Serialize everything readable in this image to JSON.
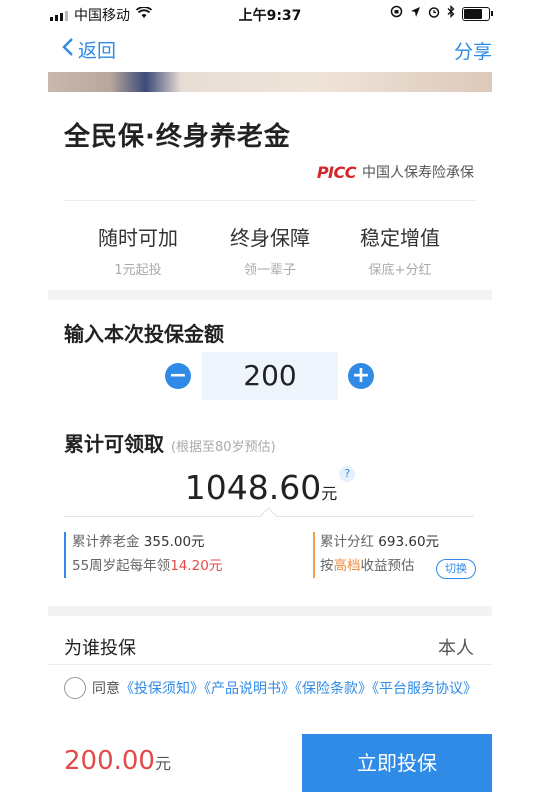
{
  "status": {
    "carrier": "中国移动",
    "time": "上午9:37"
  },
  "nav": {
    "back": "返回",
    "share": "分享"
  },
  "product": {
    "title": "全民保·终身养老金",
    "insurer_logo": "PICC",
    "insurer": "中国人保寿险承保"
  },
  "features": [
    {
      "title": "随时可加",
      "sub": "1元起投"
    },
    {
      "title": "终身保障",
      "sub": "领一辈子"
    },
    {
      "title": "稳定增值",
      "sub": "保底+分红"
    }
  ],
  "input": {
    "label": "输入本次投保金额",
    "amount": "200",
    "minus": "−",
    "plus": "+"
  },
  "total": {
    "label": "累计可领取",
    "hint": "(根据至80岁预估)",
    "value": "1048.60",
    "unit": "元",
    "help": "?"
  },
  "breakdown": {
    "pension_label": "累计养老金",
    "pension_value": "355.00元",
    "annual_prefix": "55周岁起每年领",
    "annual_value": "14.20元",
    "dividend_label": "累计分红",
    "dividend_value": "693.60元",
    "tier_prefix": "按",
    "tier_value": "高档",
    "tier_suffix": "收益预估",
    "switch": "切换"
  },
  "insured": {
    "label": "为谁投保",
    "value": "本人"
  },
  "agreement": {
    "prefix": "同意",
    "docs": [
      "《投保须知》",
      "《产品说明书》",
      "《保险条款》",
      "《平台服务协议》"
    ]
  },
  "footer": {
    "price": "200.00",
    "unit": "元",
    "buy": "立即投保"
  },
  "colors": {
    "accent": "#2f8be6",
    "price": "#e24a4a",
    "dividend": "#f0a050"
  }
}
